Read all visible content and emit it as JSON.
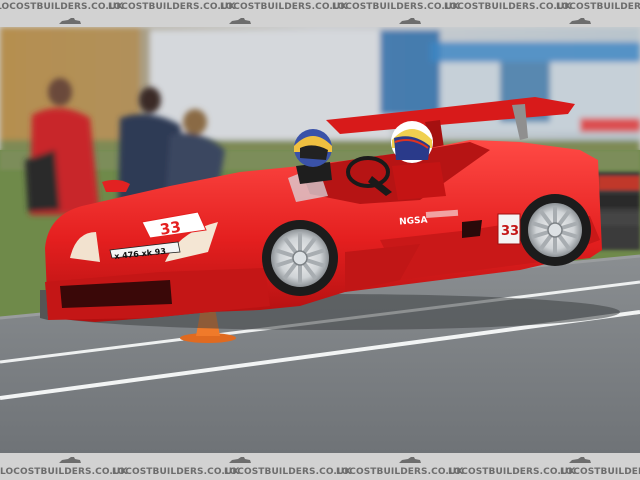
{
  "watermark": {
    "text": "LOCOSTBUILDERS.CO.UK",
    "repeat_count": 6,
    "icon": "kit-car-silhouette-icon",
    "color": "#6d6d6d"
  },
  "car": {
    "race_number": "33",
    "plate": "x 476 xk 93",
    "sponsor": "NGSA",
    "body_color": "#e41f1f"
  },
  "colors": {
    "track": "#7f8386",
    "grass": "#6f8a4a",
    "cone": "#f07a2a"
  }
}
